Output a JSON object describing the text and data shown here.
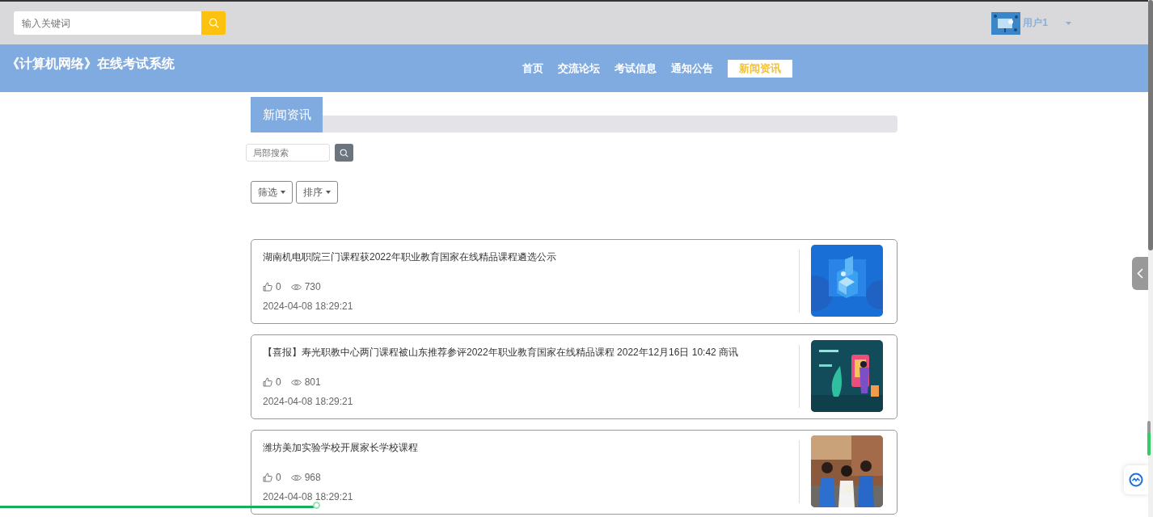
{
  "topbar": {
    "search": {
      "placeholder": "输入关键词"
    },
    "user": {
      "name": "用户1"
    }
  },
  "header": {
    "title": "《计算机网络》在线考试系统",
    "nav": [
      {
        "label": "首页",
        "selected": false
      },
      {
        "label": "交流论坛",
        "selected": false
      },
      {
        "label": "考试信息",
        "selected": false
      },
      {
        "label": "通知公告",
        "selected": false
      },
      {
        "label": "新闻资讯",
        "selected": true
      }
    ]
  },
  "section": {
    "title": "新闻资讯",
    "search": {
      "placeholder": "局部搜索"
    },
    "filters": [
      "筛选",
      "排序"
    ]
  },
  "news": [
    {
      "title": "湖南机电职院三门课程获2022年职业教育国家在线精品课程遴选公示",
      "likes": "0",
      "views": "730",
      "date": "2024-04-08 18:29:21"
    },
    {
      "title": "【喜报】寿光职教中心两门课程被山东推荐参评2022年职业教育国家在线精品课程 2022年12月16日 10:42 商讯",
      "likes": "0",
      "views": "801",
      "date": "2024-04-08 18:29:21"
    },
    {
      "title": "潍坊美加实验学校开展家长学校课程",
      "likes": "0",
      "views": "968",
      "date": "2024-04-08 18:29:21"
    }
  ],
  "progress": {
    "level": 0.277
  }
}
